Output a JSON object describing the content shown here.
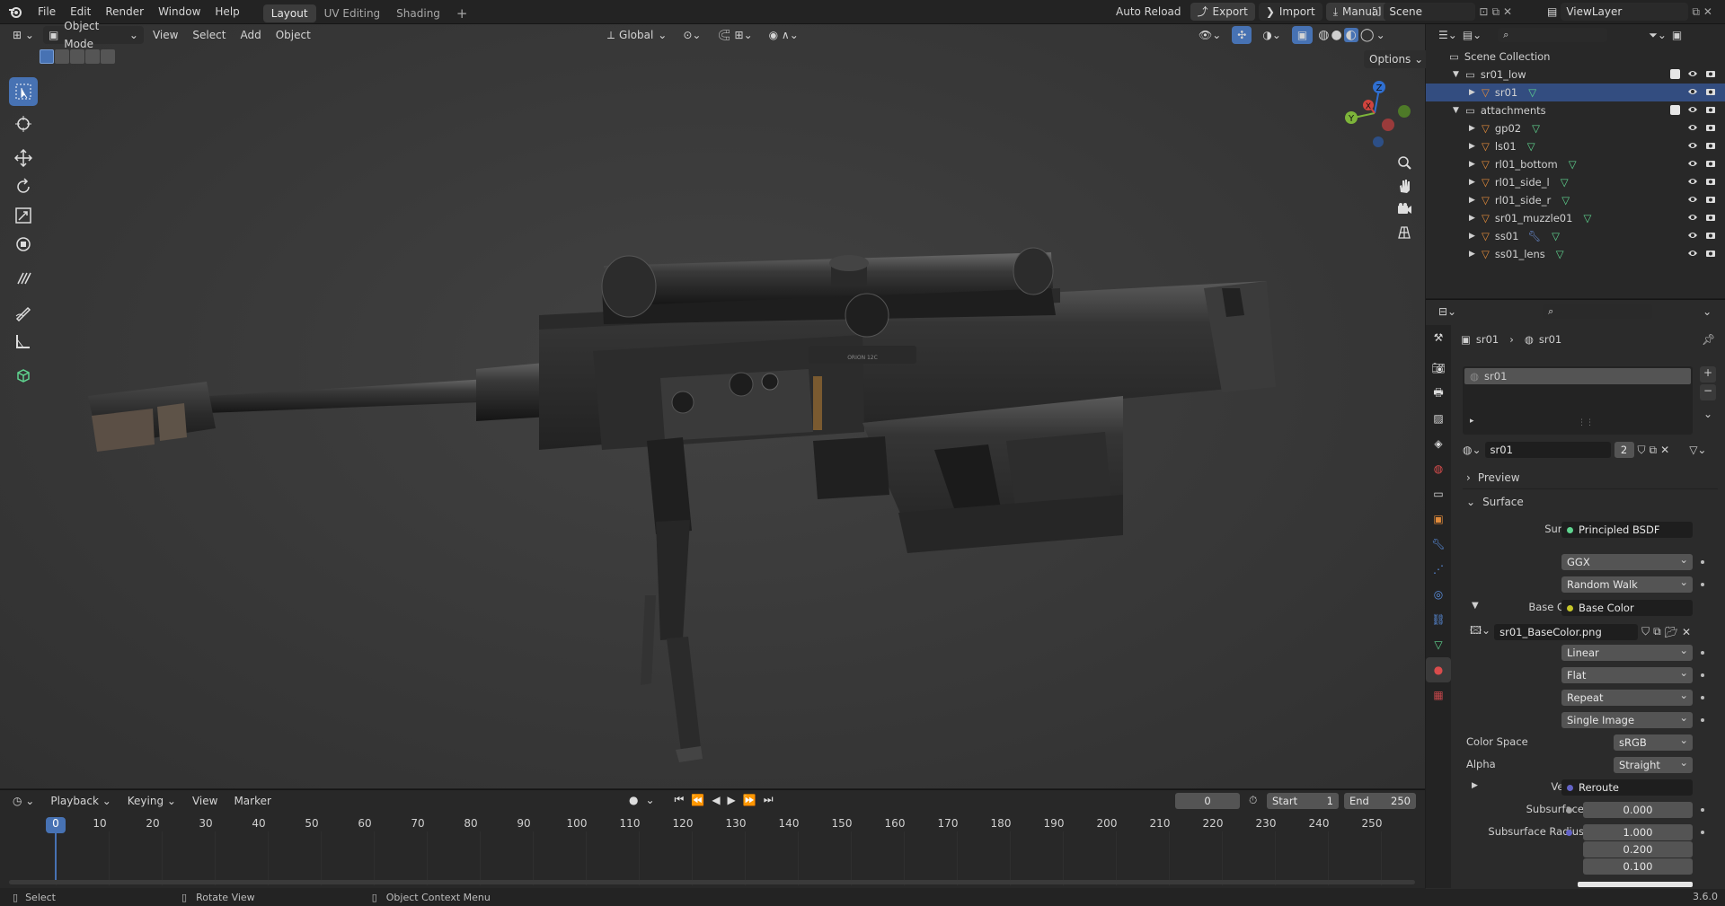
{
  "topbar": {
    "menus": [
      "File",
      "Edit",
      "Render",
      "Window",
      "Help"
    ],
    "workspaces": [
      "Layout",
      "UV Editing",
      "Shading"
    ],
    "active_workspace": "Layout",
    "add_tab": "+",
    "auto_reload": "Auto Reload",
    "export": "Export",
    "import": "Import",
    "manual": "Manual",
    "scene": "Scene",
    "view_layer": "ViewLayer"
  },
  "viewport": {
    "mode": "Object Mode",
    "menus": [
      "View",
      "Select",
      "Add",
      "Object"
    ],
    "orientation": "Global",
    "options": "Options",
    "gizmo": {
      "z": "Z",
      "y": "Y",
      "x": "X"
    },
    "scope_text": "ORION 12C"
  },
  "timeline": {
    "menus": [
      "Playback",
      "Keying",
      "View",
      "Marker"
    ],
    "current_frame": "0",
    "start_label": "Start",
    "start": "1",
    "end_label": "End",
    "end": "250",
    "ticks": [
      "0",
      "10",
      "20",
      "30",
      "40",
      "50",
      "60",
      "70",
      "80",
      "90",
      "100",
      "110",
      "120",
      "130",
      "140",
      "150",
      "160",
      "170",
      "180",
      "190",
      "200",
      "210",
      "220",
      "230",
      "240",
      "250"
    ]
  },
  "status": {
    "select": "Select",
    "rotate": "Rotate View",
    "context": "Object Context Menu",
    "version": "3.6.0"
  },
  "outliner": {
    "root": "Scene Collection",
    "collections": [
      {
        "name": "sr01_low",
        "objects": [
          {
            "name": "sr01",
            "selected": true,
            "wrench": false
          }
        ]
      },
      {
        "name": "attachments",
        "objects": [
          {
            "name": "gp02",
            "wrench": false
          },
          {
            "name": "ls01",
            "wrench": false
          },
          {
            "name": "rl01_bottom",
            "wrench": false
          },
          {
            "name": "rl01_side_l",
            "wrench": false
          },
          {
            "name": "rl01_side_r",
            "wrench": false
          },
          {
            "name": "sr01_muzzle01",
            "wrench": false
          },
          {
            "name": "ss01",
            "wrench": true
          },
          {
            "name": "ss01_lens",
            "wrench": false
          }
        ]
      }
    ]
  },
  "properties": {
    "breadcrumb_object": "sr01",
    "breadcrumb_material": "sr01",
    "slot": "sr01",
    "material_name": "sr01",
    "material_users": "2",
    "preview": "Preview",
    "surface_panel": "Surface",
    "surface_label": "Surface",
    "surface_value": "Principled BSDF",
    "distribution": "GGX",
    "subsurface_method": "Random Walk",
    "base_color_label": "Base Color",
    "base_color_value": "Base Color",
    "image_name": "sr01_BaseColor.png",
    "interpolation": "Linear",
    "projection": "Flat",
    "extension": "Repeat",
    "source": "Single Image",
    "color_space_label": "Color Space",
    "color_space": "sRGB",
    "alpha_label": "Alpha",
    "alpha": "Straight",
    "vector_label": "Vector",
    "vector_value": "Reroute",
    "subsurface_label": "Subsurface",
    "subsurface_value": "0.000",
    "subsurface_radius_label": "Subsurface Radius",
    "subsurface_radius": [
      "1.000",
      "0.200",
      "0.100"
    ]
  },
  "colors": {
    "accent": "#4772b3",
    "selected_row": "#334d80",
    "viewport_bg": "#393939"
  }
}
